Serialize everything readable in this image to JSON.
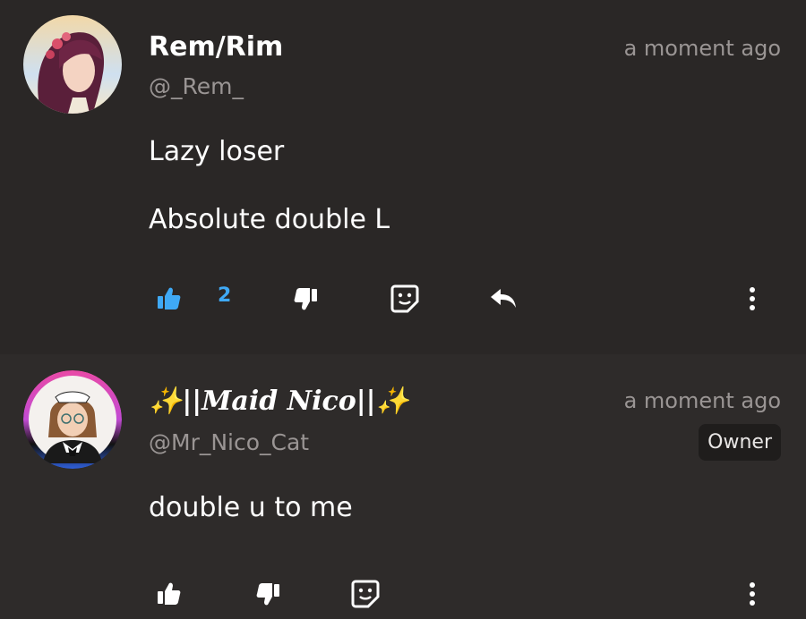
{
  "comments": [
    {
      "username": "Rem/Rim",
      "handle": "@_Rem_",
      "time": "a moment ago",
      "lines": [
        "Lazy loser",
        "Absolute double L"
      ],
      "like_count": "2",
      "liked": true,
      "icons": [
        "thumbs-up-icon",
        "thumbs-down-icon",
        "sticker-icon",
        "reply-icon",
        "more-icon"
      ]
    },
    {
      "username": "✨||Maid Nico||✨",
      "handle": "@Mr_Nico_Cat",
      "time": "a moment ago",
      "badge": "Owner",
      "lines": [
        "double u to me"
      ],
      "icons": [
        "thumbs-up-icon",
        "thumbs-down-icon",
        "sticker-icon",
        "more-icon"
      ]
    }
  ],
  "colors": {
    "accent_like": "#3fa9f5",
    "muted": "#9a9594",
    "bg1": "#2a2726",
    "bg2": "#2e2b2a"
  }
}
